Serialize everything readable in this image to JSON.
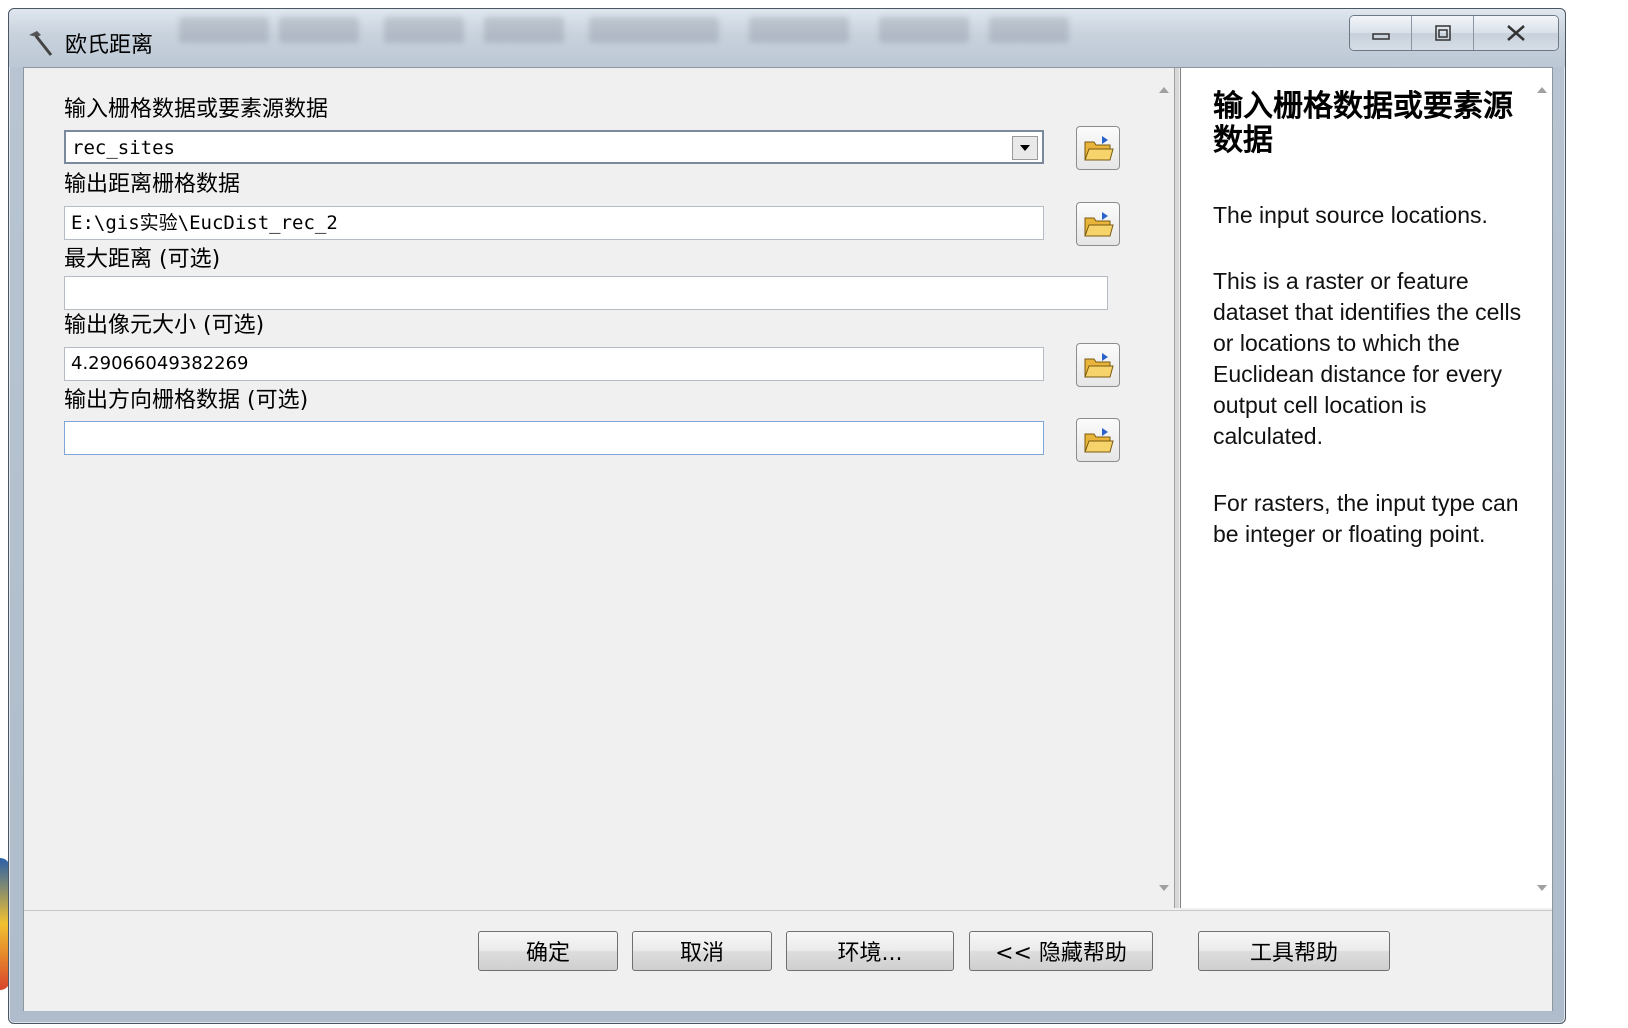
{
  "window": {
    "title": "欧氏距离"
  },
  "params": {
    "input_label": "输入栅格数据或要素源数据",
    "input_value": "rec_sites",
    "output_distance_label": "输出距离栅格数据",
    "output_distance_value": "E:\\gis实验\\EucDist_rec_2",
    "max_distance_label": "最大距离 (可选)",
    "max_distance_value": "",
    "cell_size_label": "输出像元大小 (可选)",
    "cell_size_value": "4.29066049382269",
    "direction_label": "输出方向栅格数据 (可选)",
    "direction_value": ""
  },
  "help": {
    "title": "输入栅格数据或要素源数据",
    "para1": "The input source locations.",
    "para2": "This is a raster or feature dataset that identifies the cells or locations to which the Euclidean distance for every output cell location is calculated.",
    "para3": "For rasters, the input type can be integer or floating point."
  },
  "buttons": {
    "ok": "确定",
    "cancel": "取消",
    "environments": "环境...",
    "hide_help": "<< 隐藏帮助",
    "tool_help": "工具帮助"
  },
  "icons": {
    "title": "hammer-icon",
    "browse": "folder-open-icon",
    "dropdown": "chevron-down-icon",
    "minimize": "minimize-icon",
    "maximize": "maximize-icon",
    "close": "close-icon"
  },
  "colors": {
    "folder": "#e8b43c",
    "client_bg": "#f0f0f0"
  }
}
